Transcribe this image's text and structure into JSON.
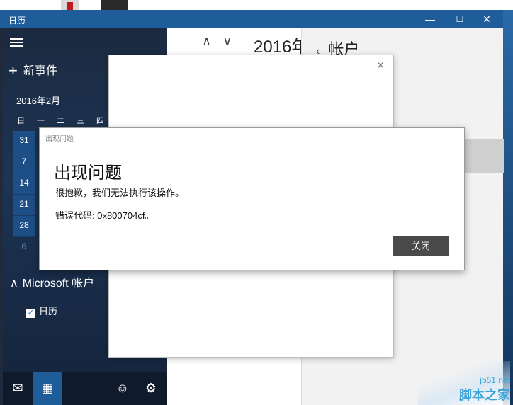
{
  "window": {
    "title": "日历",
    "minimize": "—",
    "maximize": "☐",
    "close": "✕"
  },
  "sidebar": {
    "new_event": "新事件",
    "month_title": "2016年2月",
    "weekdays": [
      "日",
      "一",
      "二",
      "三",
      "四"
    ],
    "week_starts": [
      "31",
      "7",
      "14",
      "21",
      "28",
      "6"
    ],
    "account_group": "Microsoft 帐户",
    "calendar_item": "日历"
  },
  "main": {
    "year_month": "2016年",
    "accounts_title": "帐户"
  },
  "error_dialog": {
    "caption": "出现问题",
    "heading": "出现问题",
    "message": "很抱歉，我们无法执行该操作。",
    "error_code": "错误代码: 0x800704cf。",
    "close_button": "关闭"
  },
  "watermark": {
    "line1": "jb51.net",
    "line2": "脚本之家"
  },
  "colors": {
    "titlebar": "#1e5d9a",
    "sidebar": "#1d3454",
    "dialog_button": "#4a4a4a"
  }
}
